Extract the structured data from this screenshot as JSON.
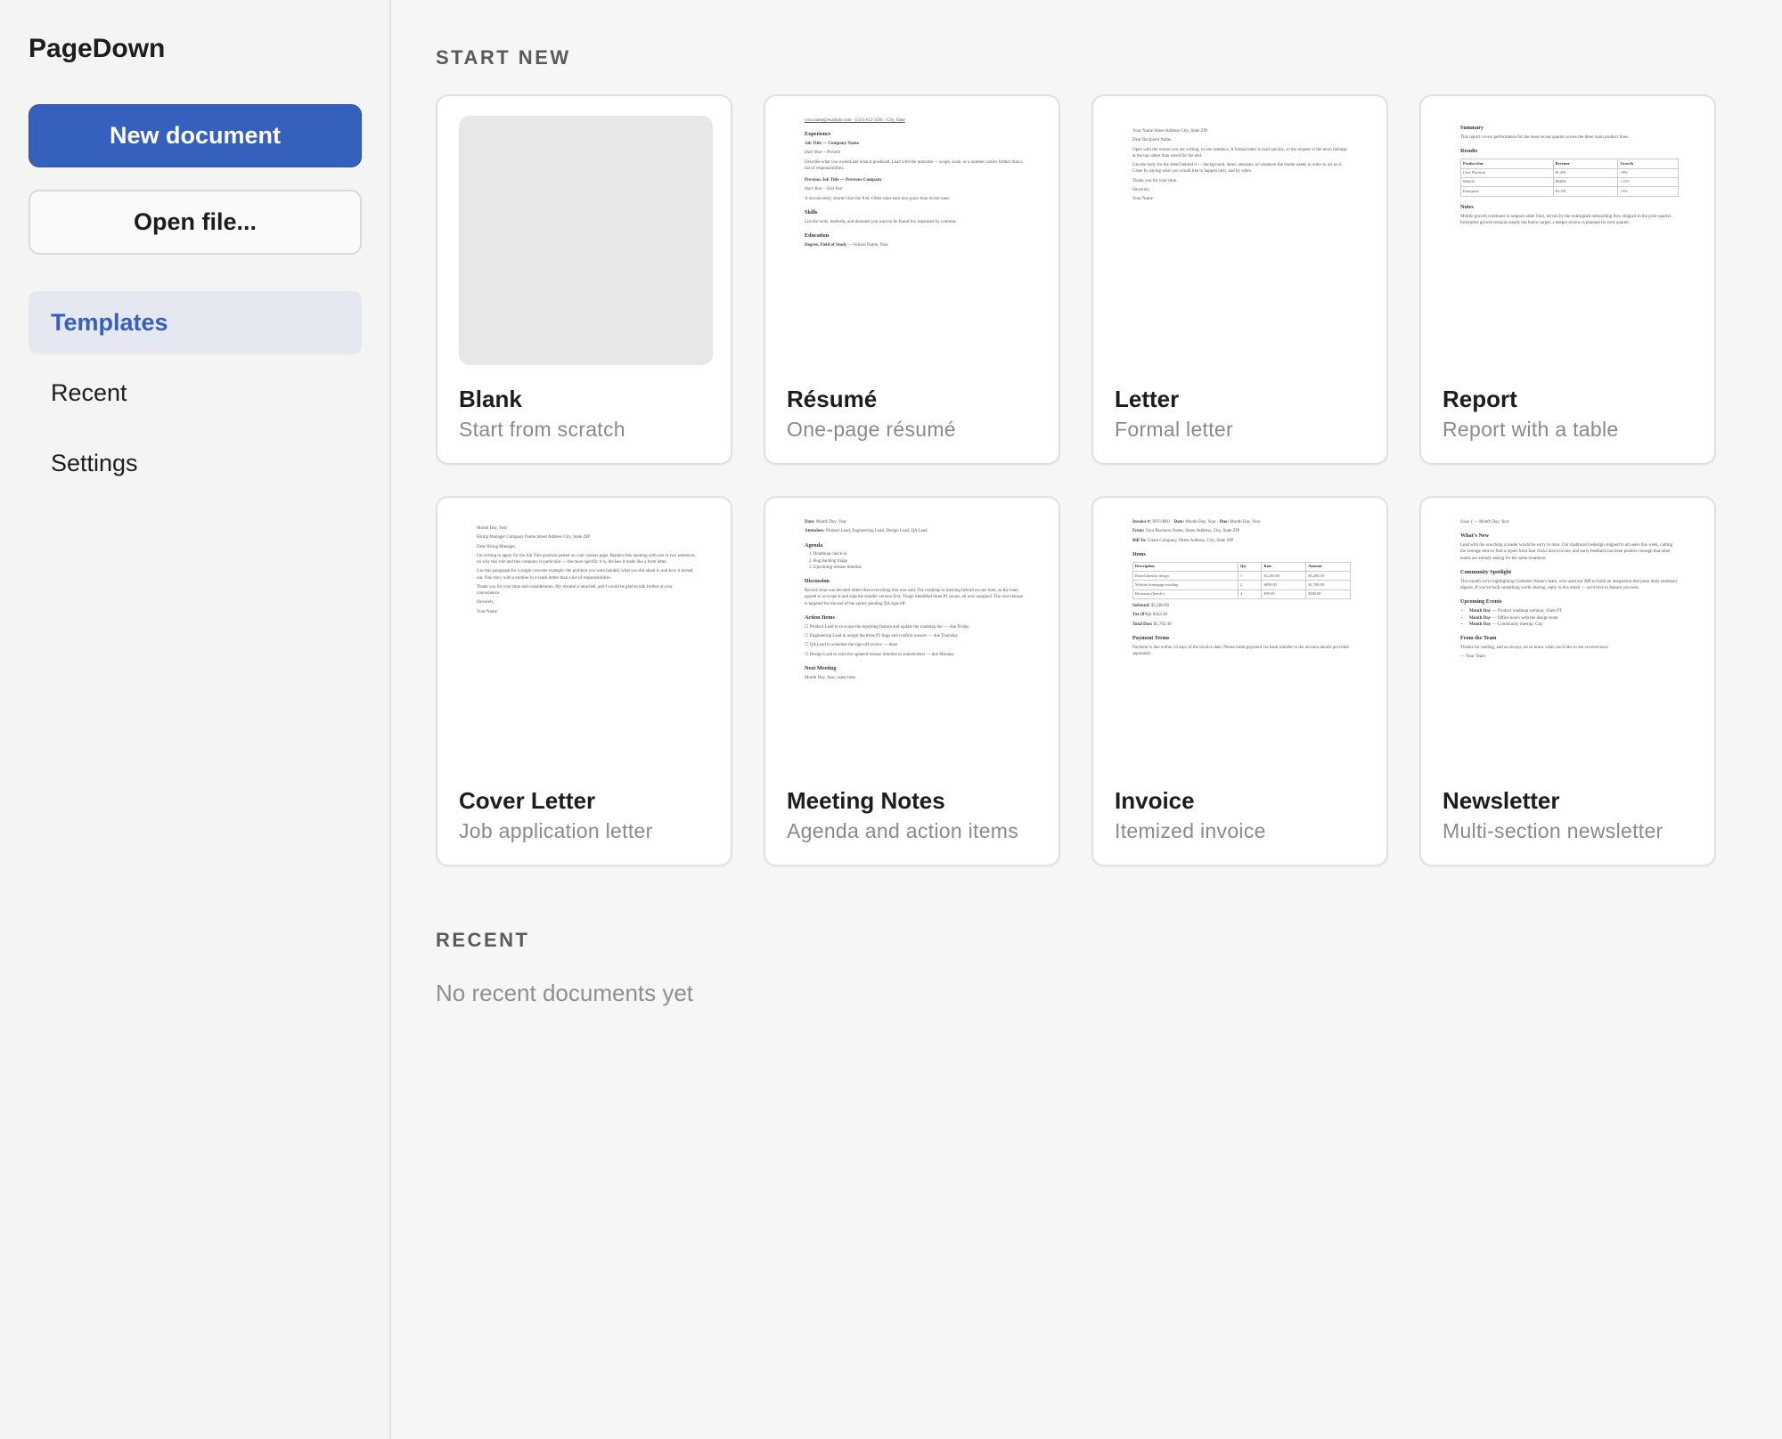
{
  "app": {
    "title": "PageDown"
  },
  "sidebar": {
    "new_document": "New document",
    "open_file": "Open file...",
    "nav": [
      {
        "label": "Templates",
        "active": true
      },
      {
        "label": "Recent",
        "active": false
      },
      {
        "label": "Settings",
        "active": false
      }
    ]
  },
  "start_new": {
    "heading": "START NEW",
    "templates": [
      {
        "title": "Blank",
        "subtitle": "Start from scratch"
      },
      {
        "title": "Résumé",
        "subtitle": "One-page résumé"
      },
      {
        "title": "Letter",
        "subtitle": "Formal letter"
      },
      {
        "title": "Report",
        "subtitle": "Report with a table"
      },
      {
        "title": "Cover Letter",
        "subtitle": "Job application letter"
      },
      {
        "title": "Meeting Notes",
        "subtitle": "Agenda and action items"
      },
      {
        "title": "Invoice",
        "subtitle": "Itemized invoice"
      },
      {
        "title": "Newsletter",
        "subtitle": "Multi-section newsletter"
      }
    ]
  },
  "recent": {
    "heading": "RECENT",
    "empty": "No recent documents yet"
  },
  "previews": {
    "resume": {
      "contact": "your.name@example.com · (555) 012-3456 · City, State",
      "h_experience": "Experience",
      "job1": "Job Title — Company Name",
      "job1_dates": "Start Year – Present",
      "job1_desc": "Describe what you owned and what it produced. Lead with the outcome — scope, scale, or a number carries further than a list of responsibilities.",
      "job2": "Previous Job Title — Previous Company",
      "job2_dates": "Start Year – End Year",
      "job2_desc": "A second entry, shorter than the first. Older roles earn less space than recent ones.",
      "h_skills": "Skills",
      "skills_desc": "List the tools, methods, and domains you want to be found for, separated by commas.",
      "h_education": "Education",
      "degree": "Degree, Field of Study",
      "school": " — School Name, Year"
    },
    "letter": {
      "sender": "Your Name Street Address City, State ZIP",
      "greeting": "Dear Recipient Name,",
      "p1": "Open with the reason you are writing, in one sentence. A formal letter is read quickly, so the request or the news belongs at the top rather than saved for the end.",
      "p2": "Use the body for the detail behind it — background, dates, amounts, or whatever the reader needs in order to act on it. Close by saying what you would like to happen next, and by when.",
      "p3": "Thank you for your time.",
      "closing": "Sincerely,",
      "signature": "Your Name"
    },
    "report": {
      "h_summary": "Summary",
      "summary": "This report covers performance for the most recent quarter across the three main product lines.",
      "h_results": "Results",
      "col_product": "Product line",
      "col_revenue": "Revenue",
      "col_growth": "Growth",
      "r1_product": "Core Platform",
      "r1_revenue": "$1.2M",
      "r1_growth": "+8%",
      "r2_product": "Mobile",
      "r2_revenue": "$640K",
      "r2_growth": "+15%",
      "r3_product": "Enterprise",
      "r3_revenue": "$3.1M",
      "r3_growth": "+3%",
      "h_notes": "Notes",
      "notes": "Mobile growth continues to outpace other lines, driven by the redesigned onboarding flow shipped in the prior quarter. Enterprise growth remains steady but below target; a deeper review is planned for next quarter."
    },
    "cover": {
      "date": "Month Day, Year",
      "recipient": "Hiring Manager Company Name Street Address City, State ZIP",
      "greeting": "Dear Hiring Manager,",
      "p1": "I'm writing to apply for the Job Title position posted on your careers page. Replace this opening with one or two sentences on why this role and this company in particular — the more specific it is, the less it reads like a form letter.",
      "p2": "Use this paragraph for a single concrete example: the problem you were handed, what you did about it, and how it turned out. One story with a number in it lands better than a list of responsibilities.",
      "p3": "Thank you for your time and consideration. My résumé is attached, and I would be glad to talk further at your convenience.",
      "closing": "Sincerely,",
      "signature": "Your Name"
    },
    "meeting": {
      "date_label": "Date:",
      "date": " Month Day, Year",
      "attendees_label": "Attendees:",
      "attendees": " Product Lead, Engineering Lead, Design Lead, QA Lead",
      "h_agenda": "Agenda",
      "agenda1": "Roadmap check-in",
      "agenda2": "Bug backlog triage",
      "agenda3": "Upcoming release timeline",
      "h_discussion": "Discussion",
      "discussion": "Record what was decided rather than everything that was said. The roadmap is tracking behind on one item, so the team agreed to re-scope it and ship the smaller version first. Triage identified three P1 issues, all now assigned. The next release is targeted for the end of the sprint, pending QA sign-off.",
      "h_action": "Action Items",
      "action1": "Product Lead to re-scope the reporting feature and update the roadmap doc — due Friday",
      "action2": "Engineering Lead to assign the three P1 bugs and confirm owners — due Thursday",
      "action3": "QA Lead to schedule the sign-off review — done",
      "action4": "Design Lead to send the updated release timeline to stakeholders — due Monday",
      "h_next": "Next Meeting",
      "next": "Month Day, Year, same time."
    },
    "invoice": {
      "invoice_no_label": "Invoice #:",
      "invoice_no": " INV-0001 · ",
      "date_label": "Date:",
      "date": " Month Day, Year · ",
      "due_label": "Due:",
      "due": " Month Day, Year",
      "from_label": "From:",
      "from": " Your Business Name, Street Address, City, State ZIP",
      "bill_label": "Bill To:",
      "bill": " Client Company, Street Address, City, State ZIP",
      "h_items": "Items",
      "col_desc": "Description",
      "col_qty": "Qty",
      "col_rate": "Rate",
      "col_amount": "Amount",
      "i1_desc": "Brand identity design",
      "i1_qty": "1",
      "i1_rate": "$3,200.00",
      "i1_amount": "$3,200.00",
      "i2_desc": "Website homepage mockup",
      "i2_qty": "2",
      "i2_rate": "$850.00",
      "i2_amount": "$1,700.00",
      "i3_desc": "Revisions (hourly)",
      "i3_qty": "4",
      "i3_rate": "$95.00",
      "i3_amount": "$380.00",
      "subtotal_label": "Subtotal:",
      "subtotal": " $5,280.00",
      "tax_label": "Tax (8%):",
      "tax": " $422.40",
      "total_label": "Total Due:",
      "total": " $5,702.40",
      "h_terms": "Payment Terms",
      "terms": "Payment is due within 14 days of the invoice date. Please remit payment via bank transfer to the account details provided separately."
    },
    "newsletter": {
      "issue": "Issue 1 — Month Day, Year",
      "h_whatsnew": "What's New",
      "whatsnew": "Lead with the one thing a reader would be sorry to miss. Our dashboard redesign shipped to all users this week, cutting the average time to find a report from four clicks down to one, and early feedback has been positive enough that other teams are already asking for the same treatment.",
      "h_spotlight": "Community Spotlight",
      "spotlight": "This month we're highlighting Customer Name's team, who used our API to build an integration that posts daily summary digests. If you've built something worth sharing, reply to this email — we'd love to feature you next.",
      "h_events": "Upcoming Events",
      "e1_date": "Month Day",
      "e1": " — Product roadmap webinar, 10am PT",
      "e2_date": "Month Day",
      "e2": " — Office hours with the design team",
      "e3_date": "Month Day",
      "e3": " — Community meetup, City",
      "h_team": "From the Team",
      "team": "Thanks for reading, and as always, let us know what you'd like to see covered next.",
      "signoff": "— Your Team"
    }
  }
}
